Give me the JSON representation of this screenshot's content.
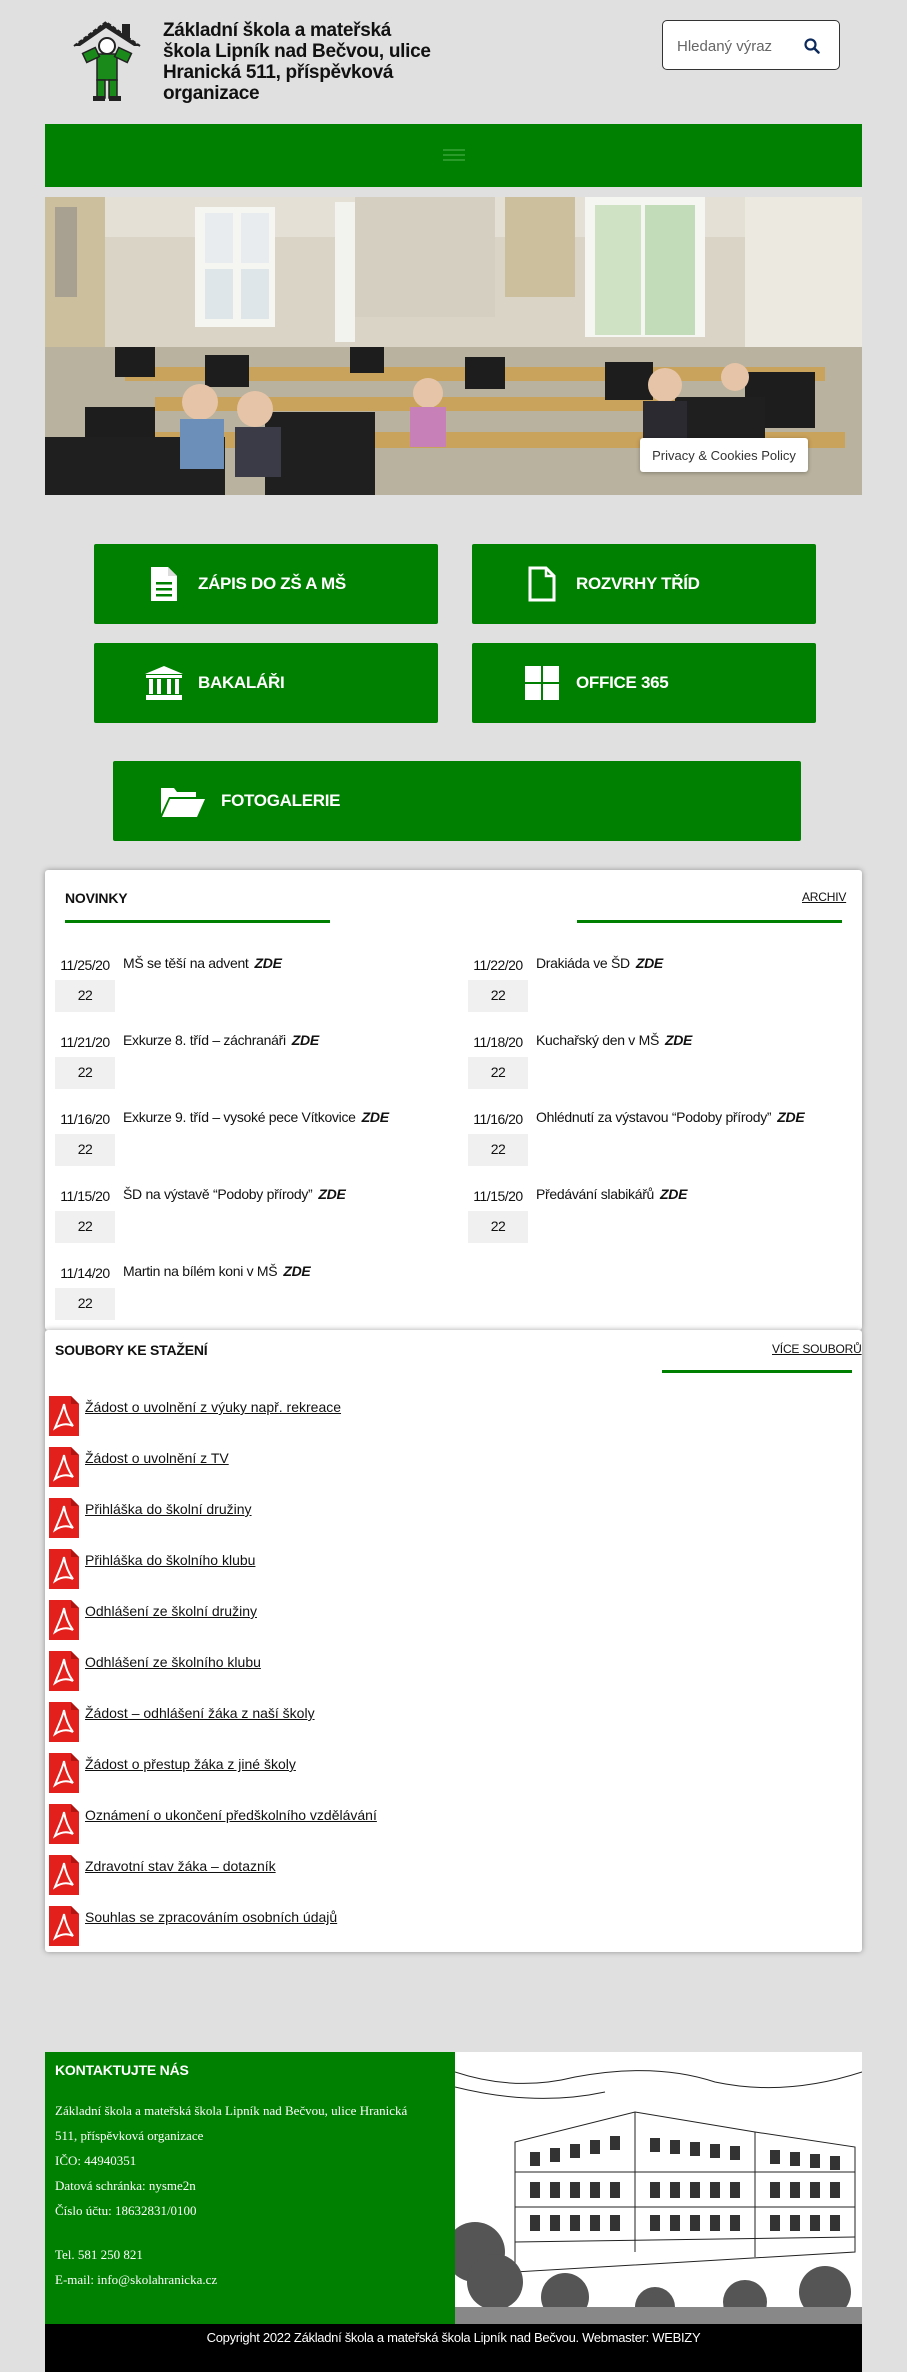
{
  "header": {
    "site_title": "Základní škola a mateřská škola Lipník nad Bečvou, ulice Hranická 511, příspěvková organizace",
    "search_placeholder": "Hledaný výraz"
  },
  "hero": {
    "privacy_label": "Privacy & Cookies Policy"
  },
  "quick_links": [
    {
      "label": "ZÁPIS DO ZŠ A MŠ",
      "icon": "document-icon"
    },
    {
      "label": "ROZVRHY TŘÍD",
      "icon": "document-outline-icon"
    },
    {
      "label": "BAKALÁŘI",
      "icon": "institution-icon"
    },
    {
      "label": "OFFICE 365",
      "icon": "windows-icon"
    },
    {
      "label": "FOTOGALERIE",
      "icon": "folder-open-icon"
    }
  ],
  "news": {
    "title": "NOVINKY",
    "archive_label": "ARCHIV",
    "link_label": "ZDE",
    "items": [
      {
        "date_top": "11/25/20",
        "date_bottom": "22",
        "text": "MŠ se těší na advent"
      },
      {
        "date_top": "11/22/20",
        "date_bottom": "22",
        "text": "Drakiáda ve ŠD"
      },
      {
        "date_top": "11/21/20",
        "date_bottom": "22",
        "text": "Exkurze 8. tříd – záchranáři"
      },
      {
        "date_top": "11/18/20",
        "date_bottom": "22",
        "text": "Kuchařský den v MŠ"
      },
      {
        "date_top": "11/16/20",
        "date_bottom": "22",
        "text": "Exkurze 9. tříd – vysoké pece Vítkovice"
      },
      {
        "date_top": "11/16/20",
        "date_bottom": "22",
        "text": "Ohlédnutí za výstavou “Podoby přírody”"
      },
      {
        "date_top": "11/15/20",
        "date_bottom": "22",
        "text": "ŠD na výstavě “Podoby přírody”"
      },
      {
        "date_top": "11/15/20",
        "date_bottom": "22",
        "text": "Předávání slabikářů"
      },
      {
        "date_top": "11/14/20",
        "date_bottom": "22",
        "text": "Martin na bílém koni v MŠ"
      }
    ]
  },
  "files": {
    "title": "SOUBORY KE STAŽENÍ",
    "more_label": "VÍCE SOUBORŮ",
    "items": [
      "Žádost o uvolnění z výuky např. rekreace",
      "Žádost o uvolnění z TV",
      "Přihláška do školní družiny",
      "Přihláška do školního klubu",
      "Odhlášení ze školní družiny",
      "Odhlášení ze školního klubu",
      "Žádost – odhlášení žáka z naší školy",
      "Žádost o přestup žáka z jiné školy",
      "Oznámení o ukončení předškolního vzdělávání",
      "Zdravotní stav žáka – dotazník",
      "Souhlas se zpracováním osobních údajů"
    ]
  },
  "footer": {
    "contact_title": "KONTAKTUJTE NÁS",
    "address_line1": "Základní škola a mateřská škola Lipník nad Bečvou, ulice Hranická",
    "address_line2": "511, příspěvková organizace",
    "ico": "IČO: 44940351",
    "datova_schranka": "Datová schránka: nysme2n",
    "cislo_uctu": "Číslo účtu: 18632831/0100",
    "tel": "Tel. 581 250 821",
    "email": "E-mail: info@skolahranicka.cz",
    "copyright": "Copyright 2022 Základní škola a mateřská škola Lipník nad Bečvou.  Webmaster: WEBIZY"
  },
  "colors": {
    "brand_green": "#008000",
    "pdf_red": "#e3201b",
    "background": "#e0e0e0"
  }
}
